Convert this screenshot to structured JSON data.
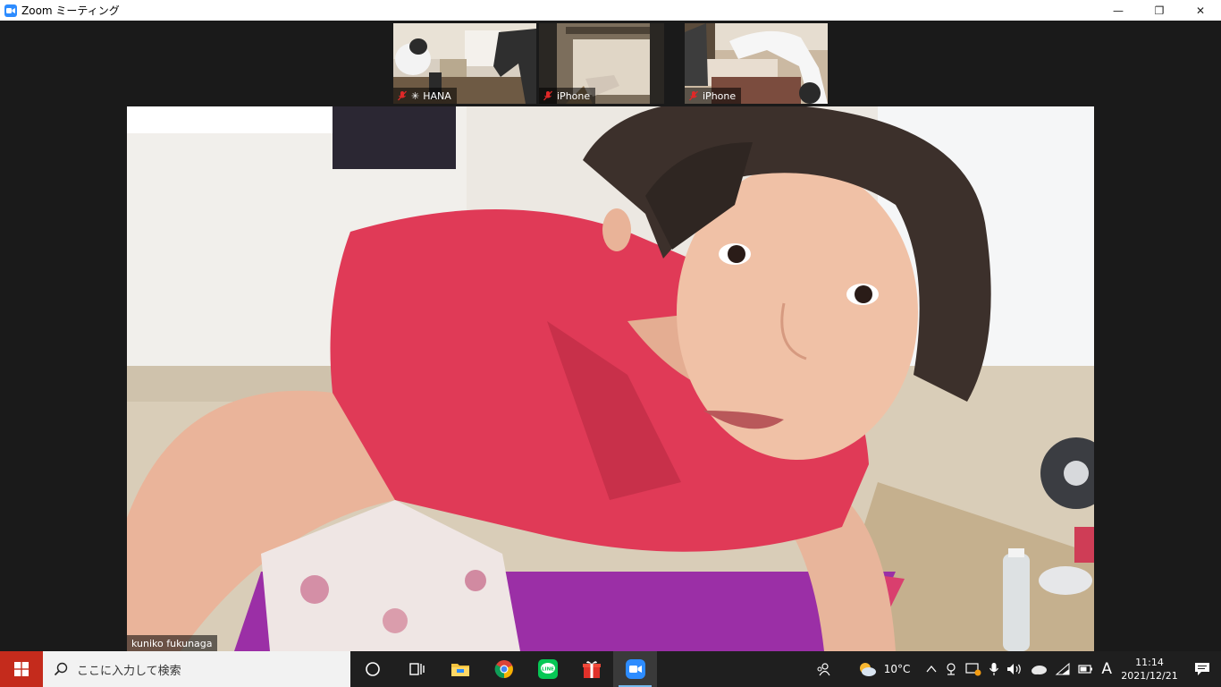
{
  "window": {
    "title": "Zoom ミーティング",
    "minimize_glyph": "—",
    "restore_glyph": "❐",
    "close_glyph": "✕"
  },
  "participants": [
    {
      "name": "HANA",
      "muted": true,
      "spotlight_glyph": "✳"
    },
    {
      "name": "iPhone",
      "muted": true
    },
    {
      "name": "iPhone",
      "muted": true
    }
  ],
  "main_speaker": {
    "name": "kuniko fukunaga"
  },
  "taskbar": {
    "search_placeholder": "ここに入力して検索",
    "apps": [
      "cortana-circle-icon",
      "task-view-icon",
      "file-explorer-icon",
      "chrome-icon",
      "line-icon",
      "gift-icon",
      "zoom-icon"
    ],
    "weather": "10°C",
    "ime_indicator": "A",
    "time": "11:14",
    "date": "2021/12/21"
  },
  "colors": {
    "zoom_blue": "#2d8cff",
    "muted_red": "#e02828",
    "taskbar_bg": "#1f1f1f"
  }
}
